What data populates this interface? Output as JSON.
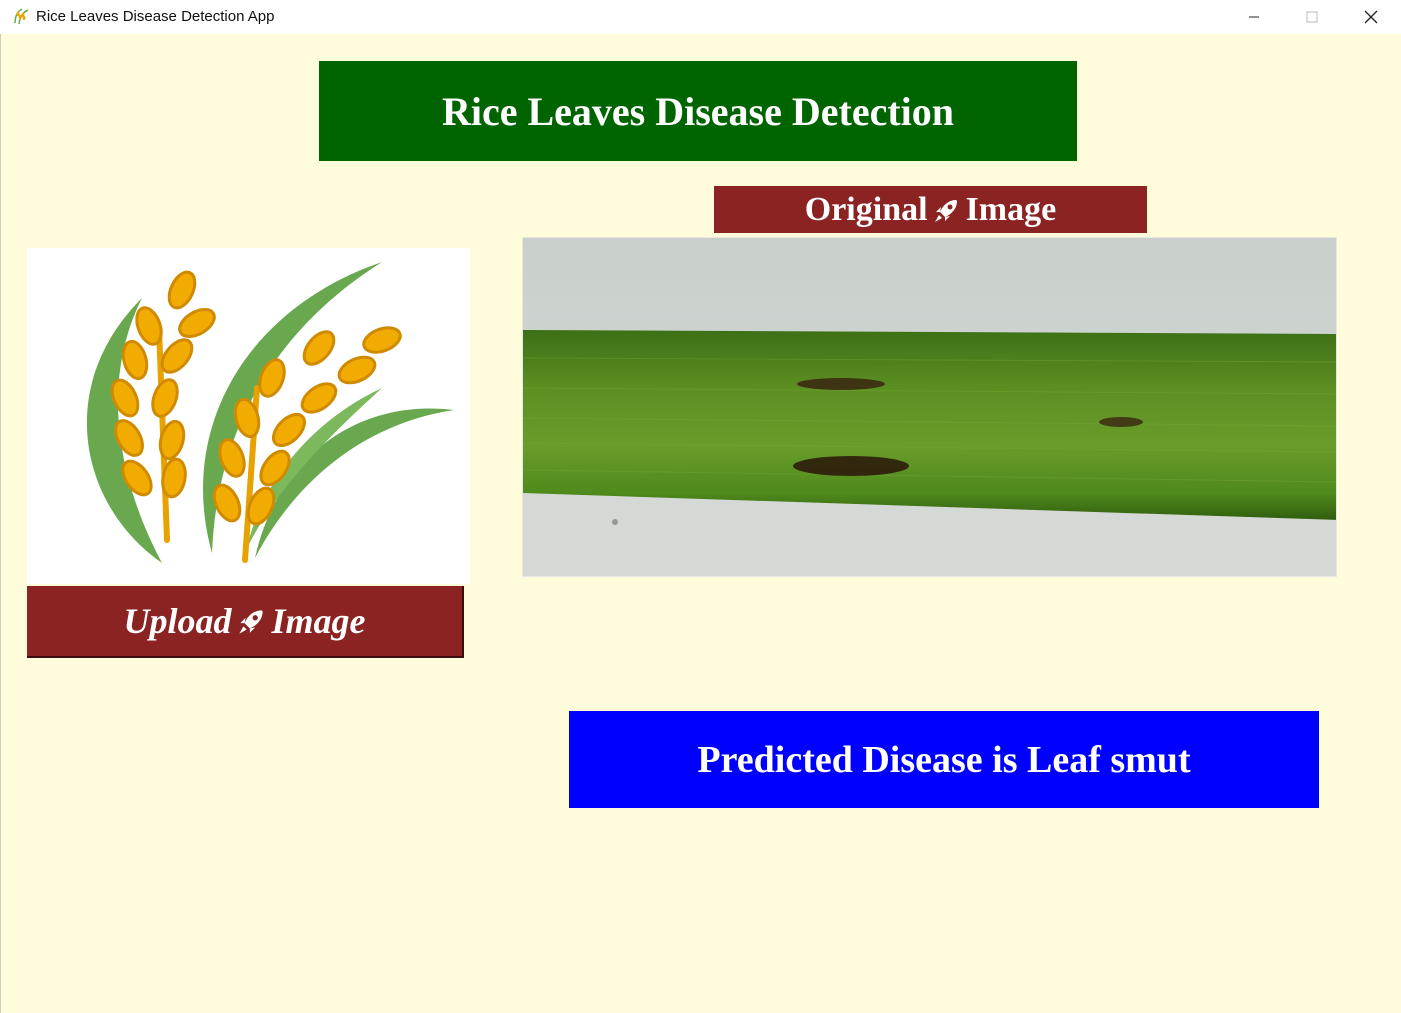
{
  "window": {
    "title": "Rice Leaves Disease Detection App",
    "icon": "rice-plant-icon",
    "controls": [
      "minimize-icon",
      "maximize-icon",
      "close-icon"
    ]
  },
  "header": {
    "title": "Rice Leaves Disease Detection"
  },
  "original_label": {
    "left": "Original",
    "icon": "rocket-icon",
    "right": "Image"
  },
  "upload_button": {
    "left": "Upload",
    "icon": "rocket-icon",
    "right": "Image"
  },
  "result": {
    "text": "Predicted Disease is Leaf smut"
  },
  "colors": {
    "background": "#fffcdc",
    "header_bg": "#006400",
    "label_bg": "#8b2323",
    "result_bg": "#0000ff",
    "text": "#ffffff"
  }
}
